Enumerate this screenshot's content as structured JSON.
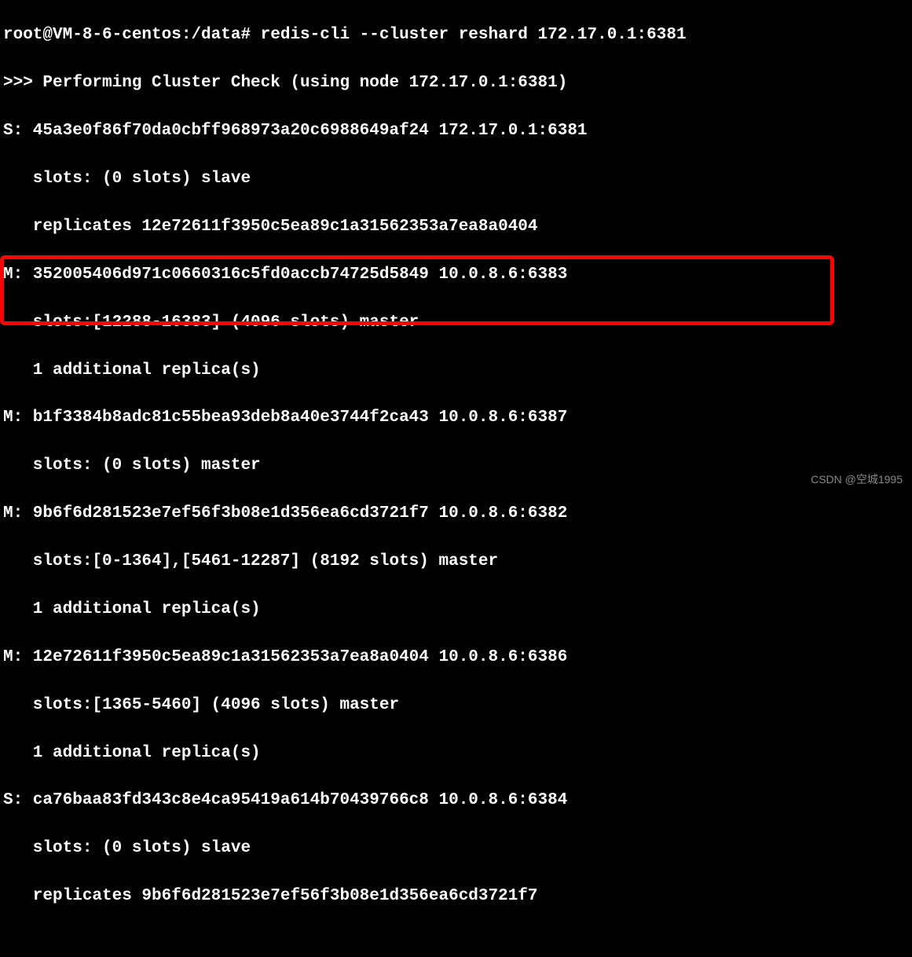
{
  "terminal": {
    "lines": [
      "root@VM-8-6-centos:/data# redis-cli --cluster reshard 172.17.0.1:6381",
      ">>> Performing Cluster Check (using node 172.17.0.1:6381)",
      "S: 45a3e0f86f70da0cbff968973a20c6988649af24 172.17.0.1:6381",
      "   slots: (0 slots) slave",
      "   replicates 12e72611f3950c5ea89c1a31562353a7ea8a0404",
      "M: 352005406d971c0660316c5fd0accb74725d5849 10.0.8.6:6383",
      "   slots:[12288-16383] (4096 slots) master",
      "   1 additional replica(s)",
      "M: b1f3384b8adc81c55bea93deb8a40e3744f2ca43 10.0.8.6:6387",
      "   slots: (0 slots) master",
      "M: 9b6f6d281523e7ef56f3b08e1d356ea6cd3721f7 10.0.8.6:6382",
      "   slots:[0-1364],[5461-12287] (8192 slots) master",
      "   1 additional replica(s)",
      "M: 12e72611f3950c5ea89c1a31562353a7ea8a0404 10.0.8.6:6386",
      "   slots:[1365-5460] (4096 slots) master",
      "   1 additional replica(s)",
      "S: ca76baa83fd343c8e4ca95419a614b70439766c8 10.0.8.6:6384",
      "   slots: (0 slots) slave",
      "   replicates 9b6f6d281523e7ef56f3b08e1d356ea6cd3721f7"
    ]
  },
  "highlight": {
    "color": "#ff0000"
  },
  "watermark": {
    "text": "CSDN @空城1995"
  }
}
